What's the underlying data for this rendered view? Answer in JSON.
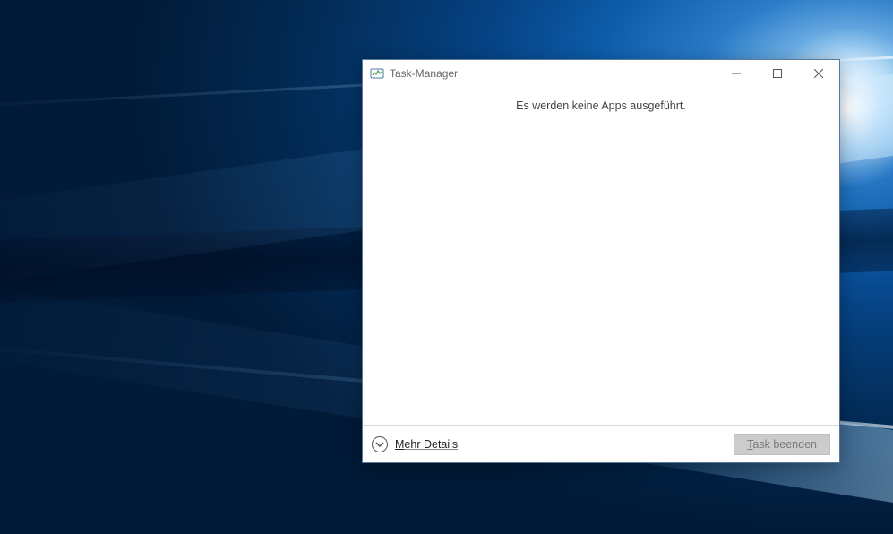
{
  "window": {
    "title": "Task-Manager",
    "status_message": "Es werden keine Apps ausgeführt."
  },
  "footer": {
    "more_details_prefix": "M",
    "more_details_rest": "ehr Details",
    "end_task_prefix": "T",
    "end_task_rest": "ask beenden"
  }
}
